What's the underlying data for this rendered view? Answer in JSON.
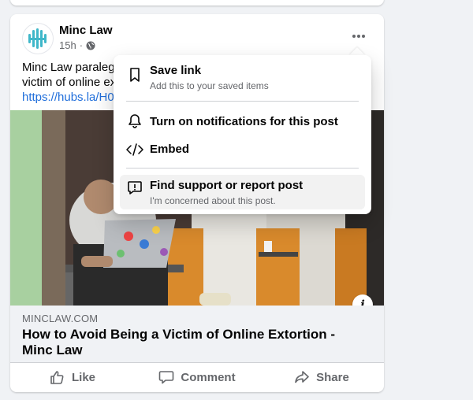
{
  "post": {
    "page_name": "Minc Law",
    "time": "15h",
    "text_line1": "Minc Law paralega",
    "text_line2": "victim of online ex",
    "link_text": "https://hubs.la/H0"
  },
  "link_preview": {
    "domain": "MINCLAW.COM",
    "headline": "How to Avoid Being a Victim of Online Extortion - Minc Law"
  },
  "actions": {
    "like": "Like",
    "comment": "Comment",
    "share": "Share"
  },
  "menu": {
    "save_title": "Save link",
    "save_sub": "Add this to your saved items",
    "notify_title": "Turn on notifications for this post",
    "embed_title": "Embed",
    "report_title": "Find support or report post",
    "report_sub": "I'm concerned about this post."
  },
  "icons": {
    "more": "more-horizontal-icon",
    "globe": "globe-icon",
    "info": "info-icon"
  }
}
